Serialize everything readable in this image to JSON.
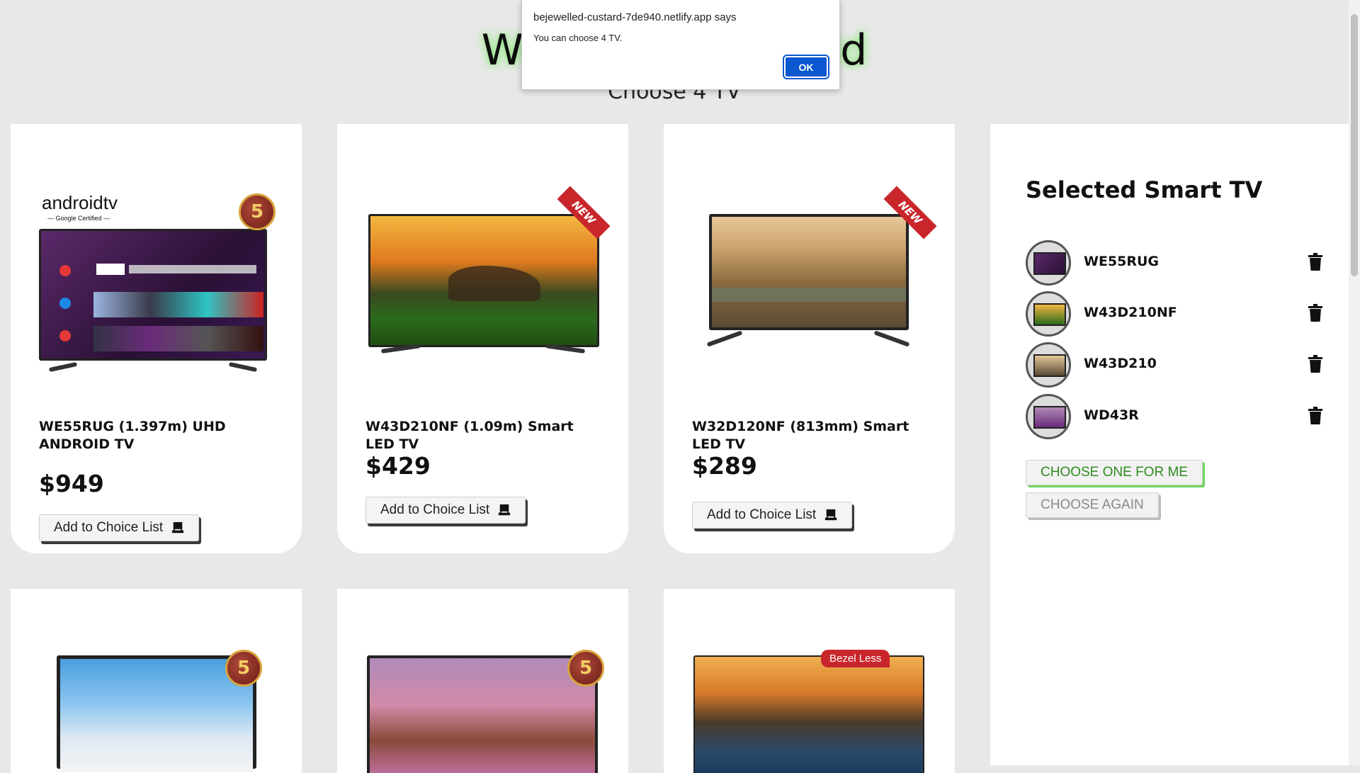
{
  "page": {
    "title": "Welcome to World",
    "subtitle": "Choose 4 TV"
  },
  "products_top": [
    {
      "name": "WE55RUG (1.397m) UHD ANDROID TV",
      "price": "$949",
      "add_label": "Add to Choice List",
      "brand_text": "androidtv",
      "brand_sub": "— Google Certified —",
      "badge": "5"
    },
    {
      "name": "W43D210NF (1.09m) Smart LED TV",
      "price": "$429",
      "add_label": "Add to Choice List",
      "ribbon": "NEW"
    },
    {
      "name": "W32D120NF (813mm) Smart LED TV",
      "price": "$289",
      "add_label": "Add to Choice List",
      "ribbon": "NEW"
    }
  ],
  "products_bottom": [
    {
      "badge": "5"
    },
    {
      "badge": "5"
    },
    {
      "tag": "Bezel Less"
    }
  ],
  "side_panel": {
    "title": "Selected Smart TV",
    "items": [
      {
        "name": "WE55RUG"
      },
      {
        "name": "W43D210NF"
      },
      {
        "name": "W43D210"
      },
      {
        "name": "WD43R"
      }
    ],
    "choose_one_label": "CHOOSE ONE FOR ME",
    "choose_again_label": "CHOOSE AGAIN"
  },
  "dialog": {
    "origin": "bejewelled-custard-7de940.netlify.app says",
    "message": "You can choose 4 TV.",
    "ok_label": "OK"
  },
  "colors": {
    "background": "#e8e8e8",
    "title_glow": "#7ee06d",
    "choose_one": "#2e8b1f",
    "dialog_button": "#0b57d0",
    "ribbon": "#c9262c"
  }
}
